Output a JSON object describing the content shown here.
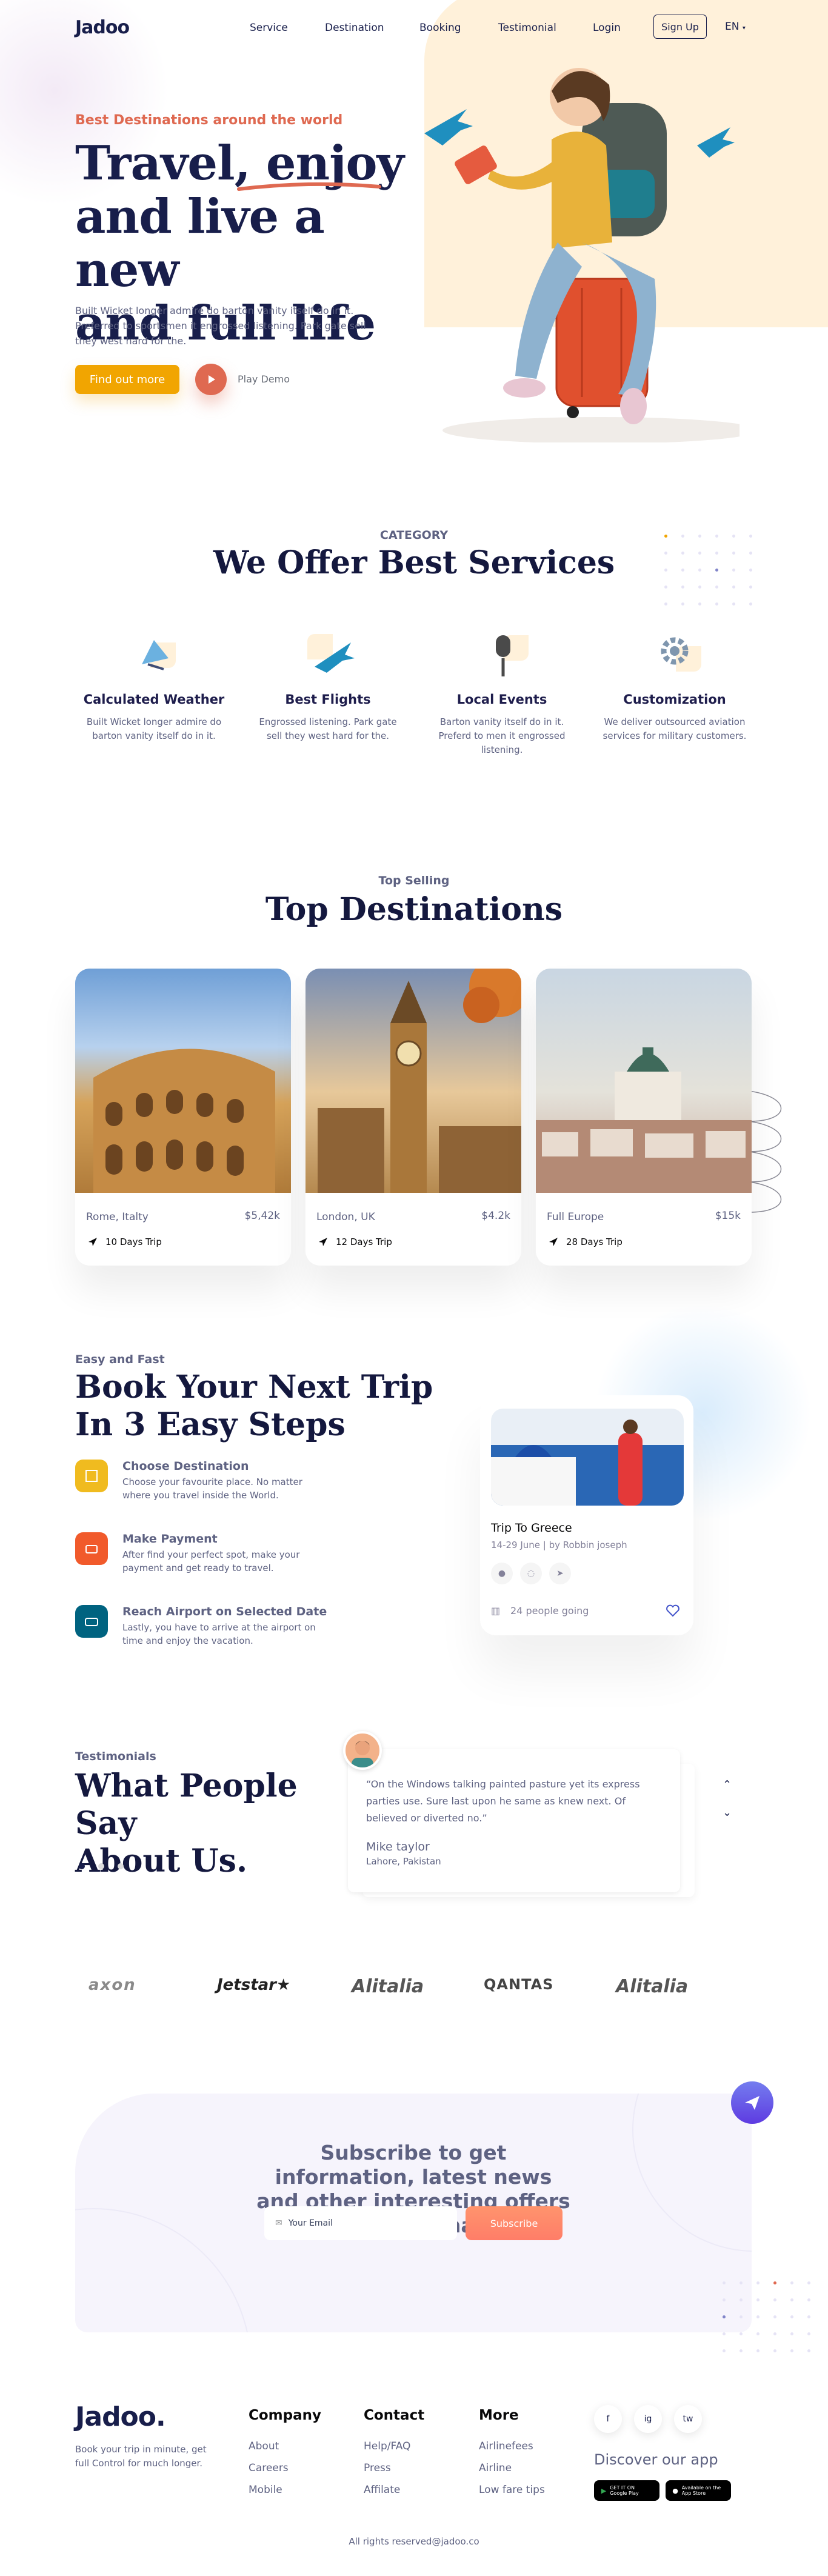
{
  "header": {
    "logo": "Jadoo",
    "nav": [
      "Service",
      "Destination",
      "Booking",
      "Testimonial",
      "Login"
    ],
    "signup": "Sign Up",
    "lang": "EN"
  },
  "hero": {
    "subtitle": "Best Destinations around the world",
    "title_line1": "Travel, enjoy",
    "title_line2": "and live a new",
    "title_line3": "and full life",
    "description": "Built Wicket longer admire do barton vanity itself do in it. Preferred to sportsmen it engrossed listening. Park gate sell they west hard for the.",
    "cta": "Find out more",
    "play_label": "Play Demo"
  },
  "services": {
    "caption": "CATEGORY",
    "title": "We Offer Best Services",
    "items": [
      {
        "title": "Calculated Weather",
        "text": "Built Wicket longer admire do barton vanity itself do in it.",
        "icon": "satellite-dish-icon"
      },
      {
        "title": "Best Flights",
        "text": "Engrossed listening. Park gate sell they west hard for the.",
        "icon": "airplane-icon"
      },
      {
        "title": "Local Events",
        "text": "Barton vanity itself do in it. Preferd to men it engrossed listening.",
        "icon": "microphone-icon"
      },
      {
        "title": "Customization",
        "text": "We deliver outsourced aviation services for military customers.",
        "icon": "gear-icon"
      }
    ]
  },
  "destinations": {
    "caption": "Top Selling",
    "title": "Top Destinations",
    "items": [
      {
        "place": "Rome, Italty",
        "price": "$5,42k",
        "trip": "10 Days Trip"
      },
      {
        "place": "London, UK",
        "price": "$4.2k",
        "trip": "12 Days Trip"
      },
      {
        "place": "Full Europe",
        "price": "$15k",
        "trip": "28 Days Trip"
      }
    ]
  },
  "steps": {
    "caption": "Easy and Fast",
    "title_line1": "Book Your Next Trip",
    "title_line2": "In 3 Easy Steps",
    "items": [
      {
        "title": "Choose Destination",
        "text": "Choose your favourite place. No matter where you travel inside the World.",
        "color": "#F0BB1F"
      },
      {
        "title": "Make Payment",
        "text": "After find your perfect spot, make your payment and get ready to travel.",
        "color": "#F15A2B"
      },
      {
        "title": "Reach Airport on Selected Date",
        "text": "Lastly, you have to arrive at the airport on time and enjoy the vacation.",
        "color": "#006380"
      }
    ],
    "card": {
      "title": "Trip To Greece",
      "meta": "14-29 June | by Robbin joseph",
      "going": "24 people going"
    }
  },
  "testimonials": {
    "caption": "Testimonials",
    "title_line1": "What People Say",
    "title_line2": "About Us.",
    "quote": "“On the Windows talking painted pasture yet its express parties use. Sure last upon he same as knew next. Of believed or diverted no.”",
    "name": "Mike taylor",
    "location": "Lahore, Pakistan"
  },
  "partners": [
    "axon",
    "Jetstar",
    "Alitalia",
    "QANTAS",
    "Alitalia"
  ],
  "subscribe": {
    "title": "Subscribe to get information, latest news and other interesting offers about Cobham",
    "placeholder": "Your Email",
    "button": "Subscribe"
  },
  "footer": {
    "logo": "Jadoo.",
    "description": "Book your trip in minute, get full Control for much longer.",
    "columns": [
      {
        "title": "Company",
        "links": [
          "About",
          "Careers",
          "Mobile"
        ]
      },
      {
        "title": "Contact",
        "links": [
          "Help/FAQ",
          "Press",
          "Affilate"
        ]
      },
      {
        "title": "More",
        "links": [
          "Airlinefees",
          "Airline",
          "Low fare tips"
        ]
      }
    ],
    "social": [
      "f",
      "ig",
      "tw"
    ],
    "discover": "Discover our app",
    "google_play": "GET IT ON Google Play",
    "app_store": "Available on the App Store",
    "copyright": "All rights reserved@jadoo.co"
  },
  "colors": {
    "navy": "#181E4B",
    "orange": "#DF6951",
    "yellow": "#F1A501",
    "grey": "#5E6282"
  }
}
